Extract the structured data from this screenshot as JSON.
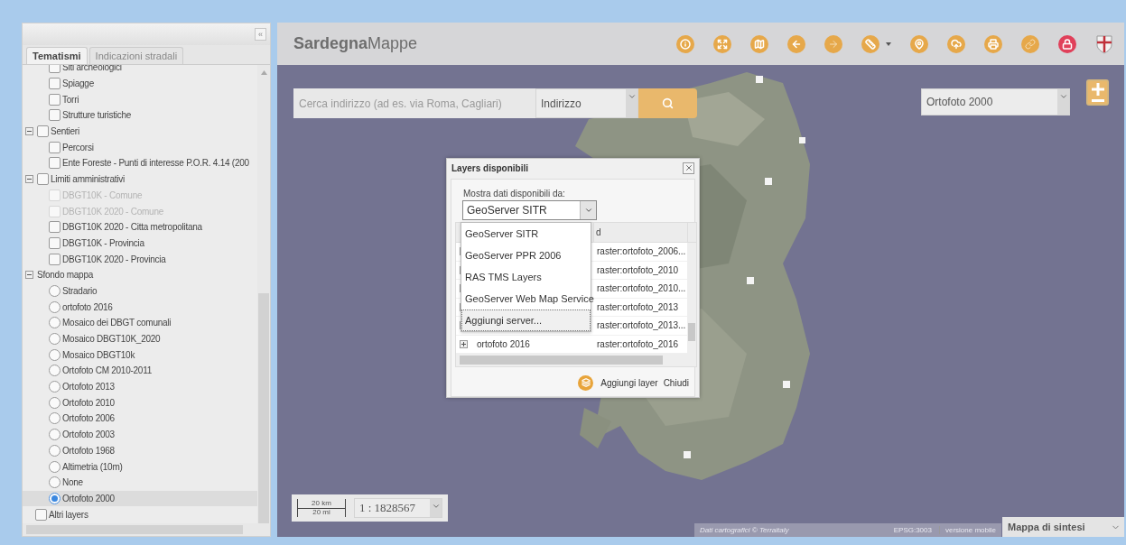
{
  "sidebar": {
    "collapse_button": "«",
    "tabs": [
      {
        "label": "Tematismi",
        "selected": true
      },
      {
        "label": "Indicazioni stradali",
        "selected": false
      }
    ],
    "tree": [
      {
        "kind": "continued",
        "children": [
          {
            "kind": "check",
            "label": "Siti archeologici",
            "checked": false,
            "disabled": false
          },
          {
            "kind": "check",
            "label": "Spiagge",
            "checked": false,
            "disabled": false
          },
          {
            "kind": "check",
            "label": "Torri",
            "checked": false,
            "disabled": false
          },
          {
            "kind": "check",
            "label": "Strutture turistiche",
            "checked": false,
            "disabled": false
          }
        ]
      },
      {
        "kind": "group",
        "label": "Sentieri",
        "checked": false,
        "expanded": true,
        "children": [
          {
            "kind": "check",
            "label": "Percorsi",
            "checked": false,
            "disabled": false
          },
          {
            "kind": "check",
            "label": "Ente Foreste - Punti di interesse P.O.R. 4.14 (200",
            "checked": false,
            "disabled": false
          }
        ]
      },
      {
        "kind": "group",
        "label": "Limiti amministrativi",
        "checked": false,
        "expanded": true,
        "children": [
          {
            "kind": "check",
            "label": "DBGT10K - Comune",
            "checked": false,
            "disabled": true
          },
          {
            "kind": "check",
            "label": "DBGT10K 2020 - Comune",
            "checked": false,
            "disabled": true
          },
          {
            "kind": "check",
            "label": "DBGT10K 2020 - Citta metropolitana",
            "checked": false,
            "disabled": false
          },
          {
            "kind": "check",
            "label": "DBGT10K - Provincia",
            "checked": false,
            "disabled": false
          },
          {
            "kind": "check",
            "label": "DBGT10K 2020 - Provincia",
            "checked": false,
            "disabled": false
          }
        ]
      },
      {
        "kind": "folder",
        "label": "Sfondo mappa",
        "expanded": true,
        "children": [
          {
            "kind": "radio",
            "label": "Stradario",
            "selected": false
          },
          {
            "kind": "radio",
            "label": "ortofoto 2016",
            "selected": false
          },
          {
            "kind": "radio",
            "label": "Mosaico dei DBGT comunali",
            "selected": false
          },
          {
            "kind": "radio",
            "label": "Mosaico DBGT10K_2020",
            "selected": false
          },
          {
            "kind": "radio",
            "label": "Mosaico DBGT10k",
            "selected": false
          },
          {
            "kind": "radio",
            "label": "Ortofoto CM 2010-2011",
            "selected": false
          },
          {
            "kind": "radio",
            "label": "Ortofoto 2013",
            "selected": false
          },
          {
            "kind": "radio",
            "label": "Ortofoto 2010",
            "selected": false
          },
          {
            "kind": "radio",
            "label": "Ortofoto 2006",
            "selected": false
          },
          {
            "kind": "radio",
            "label": "Ortofoto 2003",
            "selected": false
          },
          {
            "kind": "radio",
            "label": "Ortofoto 1968",
            "selected": false
          },
          {
            "kind": "radio",
            "label": "Altimetria (10m)",
            "selected": false
          },
          {
            "kind": "radio",
            "label": "None",
            "selected": false
          },
          {
            "kind": "radio",
            "label": "Ortofoto 2000",
            "selected": true
          }
        ]
      },
      {
        "kind": "leafcheck",
        "label": "Altri layers",
        "checked": false,
        "disabled": false
      }
    ]
  },
  "header": {
    "brand_bold": "Sardegna",
    "brand_light": "Mappe",
    "tools": [
      {
        "disabled": false,
        "menu": false,
        "color": "#e6a84a"
      },
      {
        "disabled": false,
        "menu": false,
        "color": "#e6a84a"
      },
      {
        "disabled": false,
        "menu": false,
        "color": "#e6a84a"
      },
      {
        "disabled": false,
        "menu": false,
        "color": "#e6a84a"
      },
      {
        "disabled": true,
        "menu": false,
        "color": "#e6a84a"
      },
      {
        "disabled": false,
        "menu": true,
        "color": "#e6a84a"
      },
      {
        "disabled": false,
        "menu": false,
        "color": "#e6a84a"
      },
      {
        "disabled": false,
        "menu": false,
        "color": "#e6a84a"
      },
      {
        "disabled": false,
        "menu": false,
        "color": "#e6a84a"
      },
      {
        "disabled": true,
        "menu": false,
        "color": "#e6a84a"
      },
      {
        "disabled": false,
        "menu": false,
        "color": "#e0405a"
      }
    ]
  },
  "map": {
    "search": {
      "placeholder": "Cerca indirizzo (ad es. via Roma, Cagliari)",
      "type": "Indirizzo"
    },
    "basemap_select": "Ortofoto 2000",
    "scale": {
      "km": "20 km",
      "mi": "20 mi",
      "ratio": "1 : 1828567"
    },
    "attribution": "Dati cartografici © Terraitaly",
    "projection": "EPSG:3003",
    "mobile_link": "versione mobile",
    "overview": "Mappa di sintesi"
  },
  "dialog": {
    "title": "Layers disponibili",
    "source_label": "Mostra dati disponibili da:",
    "source": "GeoServer SITR",
    "options": [
      {
        "label": "GeoServer SITR",
        "focused": false
      },
      {
        "label": "GeoServer PPR 2006",
        "focused": false
      },
      {
        "label": "RAS TMS Layers",
        "focused": false
      },
      {
        "label": "GeoServer Web Map Service",
        "focused": false
      },
      {
        "label": "Aggiungi server...",
        "focused": true
      }
    ],
    "column_2_header": "d",
    "rows": [
      {
        "column_2": "raster:ortofoto_2006..."
      },
      {
        "column_2": "raster:ortofoto_2010"
      },
      {
        "column_2": "raster:ortofoto_2010..."
      },
      {
        "column_2": "raster:ortofoto_2013"
      },
      {
        "column_2": "raster:ortofoto_2013..."
      },
      {
        "expanded": false,
        "column_1": "ortofoto 2016",
        "column_2": "raster:ortofoto_2016"
      }
    ],
    "buttons": [
      "Aggiungi layer",
      "Chiudi"
    ]
  }
}
